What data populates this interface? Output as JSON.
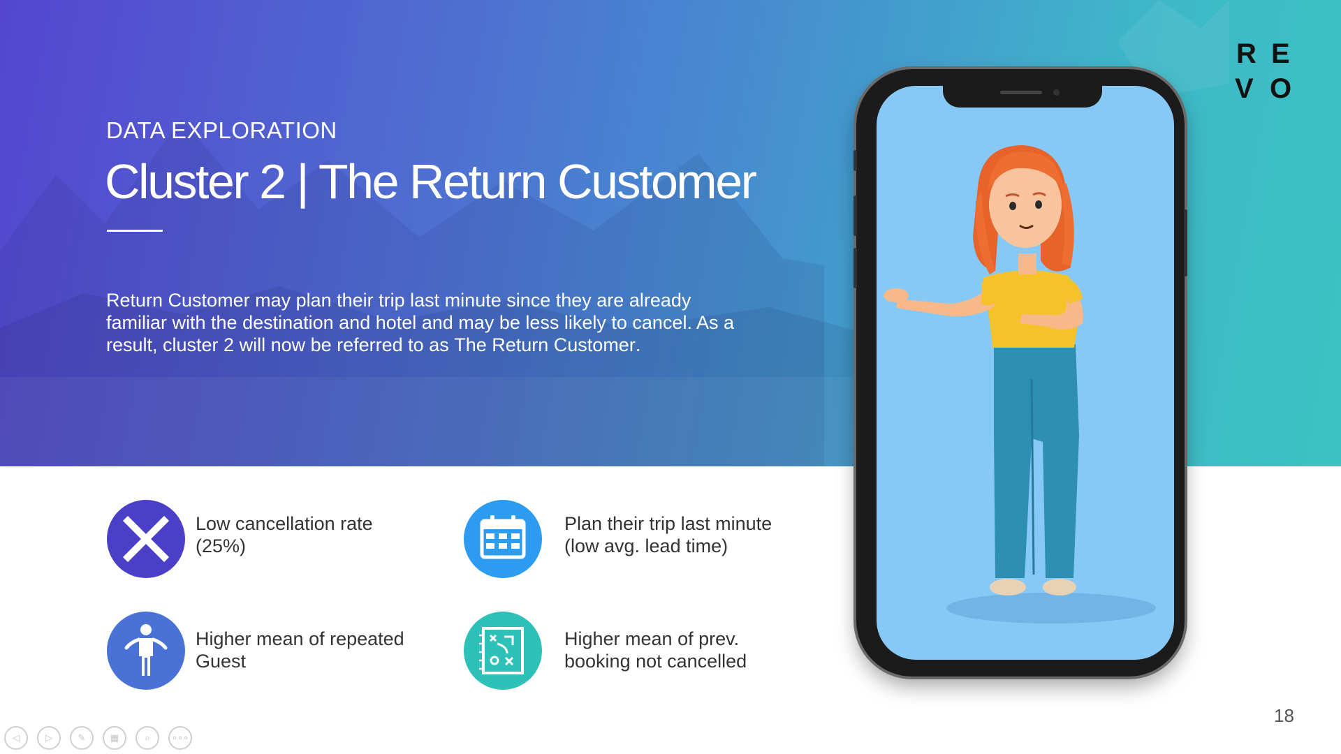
{
  "slide": {
    "overline": "DATA EXPLORATION",
    "title": "Cluster 2 | The Return Customer",
    "description_lead": "Return Customer may plan their trip last minute since they are already familiar with the destination and hotel and may be less likely to cancel. As a result, cluster 2 will now be referred to as ",
    "description_emphasis": "The Return Customer",
    "description_tail": ".",
    "page_number": "18",
    "logo_letters": [
      "R",
      "E",
      "V",
      "O"
    ]
  },
  "features": [
    {
      "icon": "x-cross-icon",
      "line1": "Low cancellation rate",
      "line2": "(25%)",
      "color": "#4b3fc7"
    },
    {
      "icon": "calendar-icon",
      "line1": "Plan their trip last minute",
      "line2": "(low avg. lead time)",
      "color": "#2d9cf0"
    },
    {
      "icon": "person-icon",
      "line1": "Higher mean of repeated",
      "line2": "Guest",
      "color": "#4a72d6"
    },
    {
      "icon": "strategy-board-icon",
      "line1": "Higher mean of prev.",
      "line2": "booking not cancelled",
      "color": "#2ec1b8"
    }
  ],
  "colors": {
    "hero_start": "#5446cf",
    "hero_end": "#3cc3c2",
    "phone_screen": "#86c9f6"
  },
  "controls": [
    {
      "icon": "previous-icon",
      "glyph": "◁"
    },
    {
      "icon": "next-icon",
      "glyph": "▷"
    },
    {
      "icon": "pen-icon",
      "glyph": "✎"
    },
    {
      "icon": "slides-grid-icon",
      "glyph": "▦"
    },
    {
      "icon": "zoom-icon",
      "glyph": "⌕"
    },
    {
      "icon": "more-options-icon",
      "glyph": "∘∘∘"
    }
  ]
}
